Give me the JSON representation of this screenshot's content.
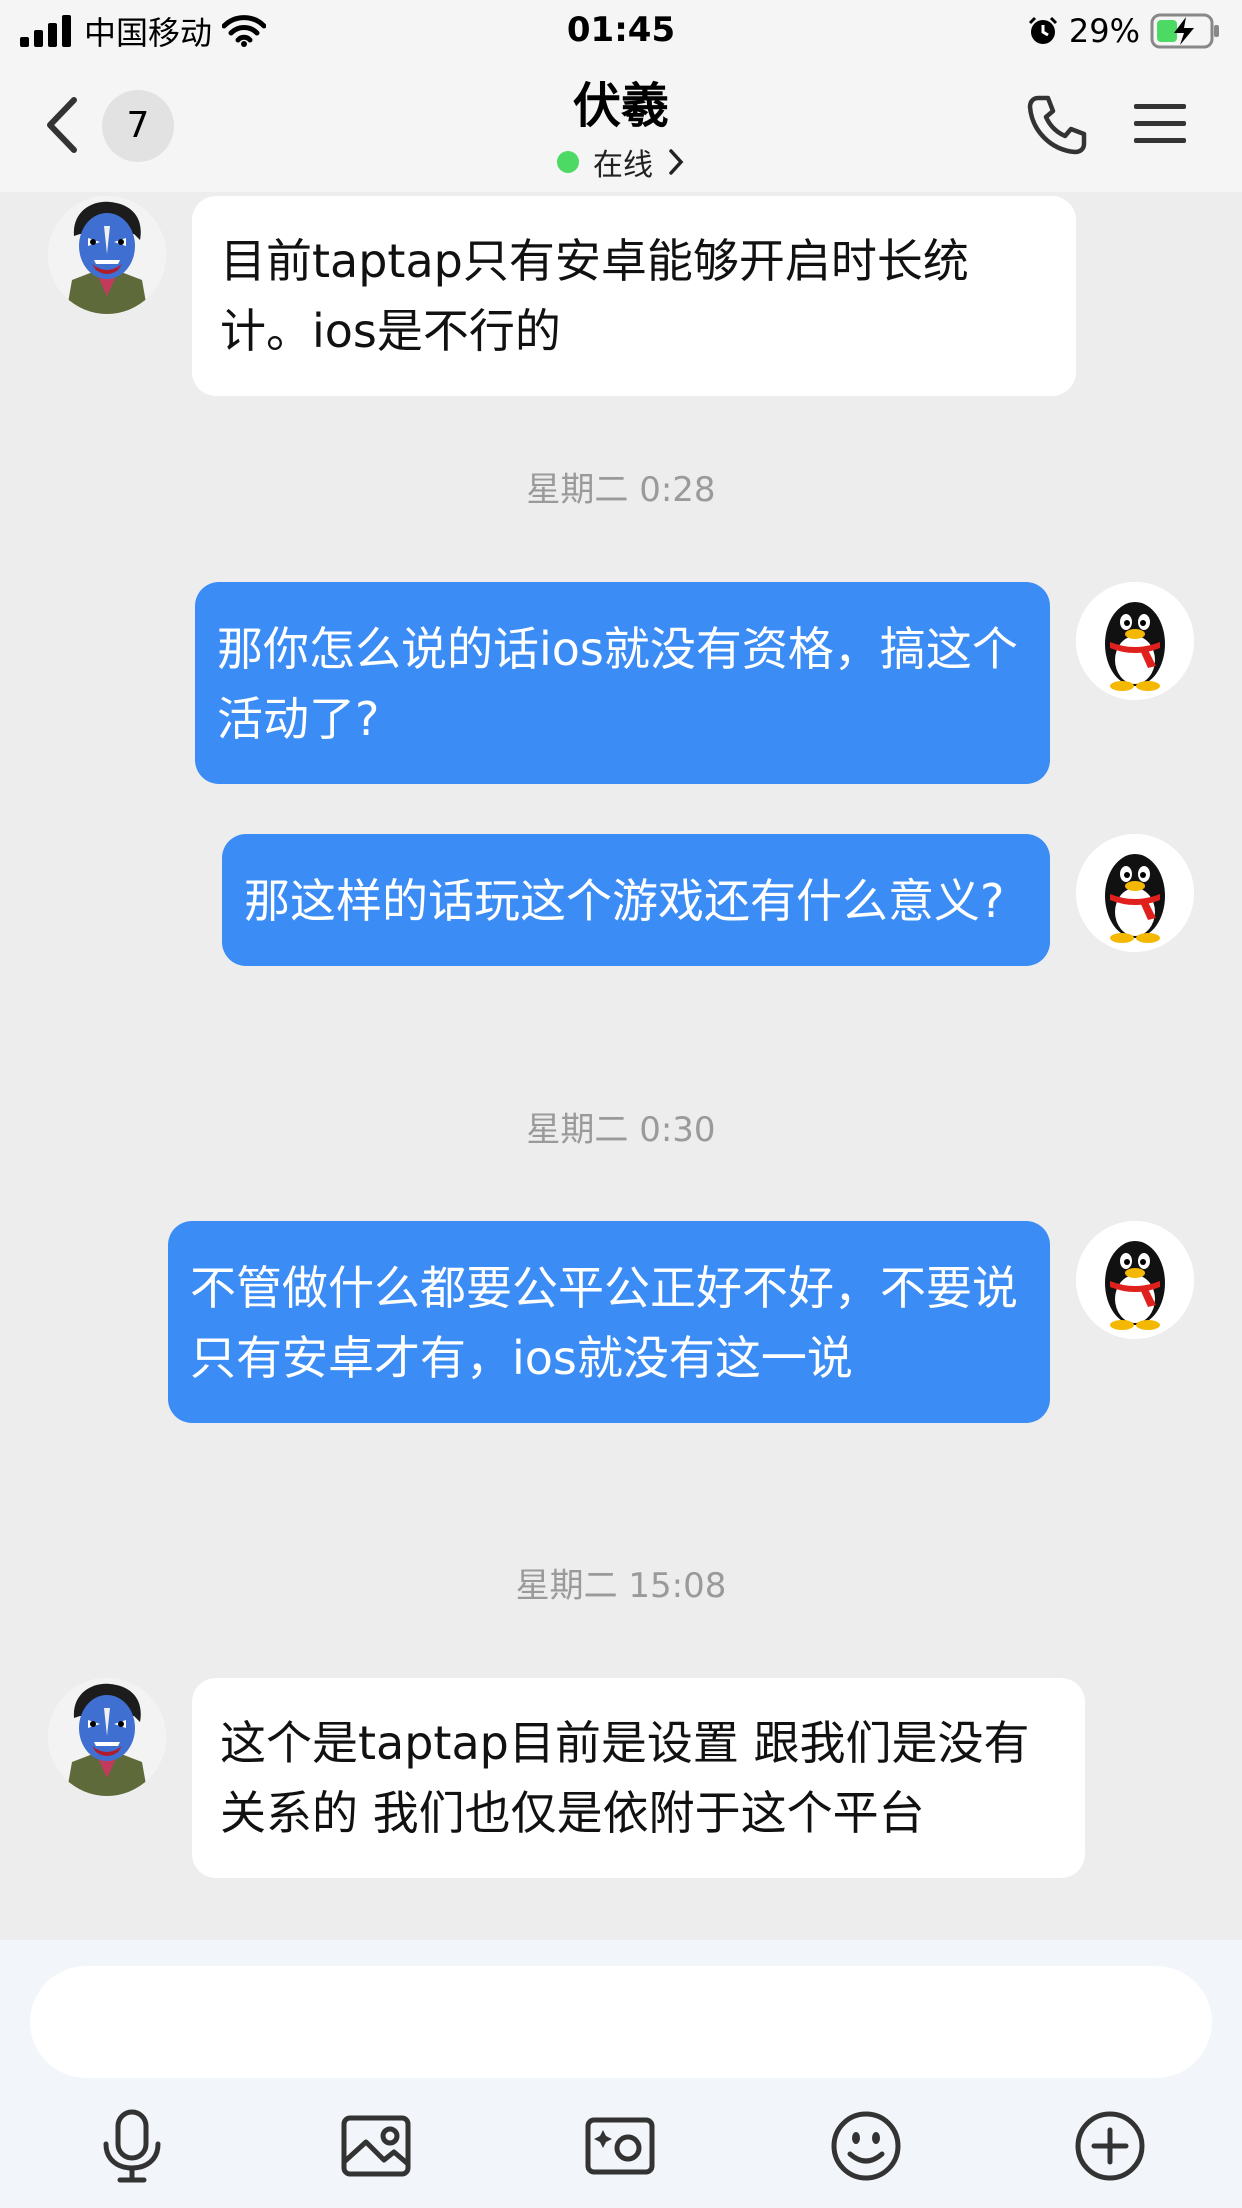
{
  "status_bar": {
    "carrier": "中国移动",
    "time": "01:45",
    "battery": "29%"
  },
  "nav": {
    "unread_count": "7",
    "contact_name": "伏羲",
    "status_text": "在线"
  },
  "messages": [
    {
      "from": "contact",
      "text": "目前taptap只有安卓能够开启时长统计。ios是不行的"
    },
    {
      "timestamp": "星期二 0:28"
    },
    {
      "from": "me",
      "text": "那你怎么说的话ios就没有资格，搞这个活动了?"
    },
    {
      "from": "me",
      "text": "那这样的话玩这个游戏还有什么意义?"
    },
    {
      "timestamp": "星期二 0:30"
    },
    {
      "from": "me",
      "text": "不管做什么都要公平公正好不好，不要说只有安卓才有，ios就没有这一说"
    },
    {
      "timestamp": "星期二 15:08"
    },
    {
      "from": "contact",
      "text": "这个是taptap目前是设置 跟我们是没有关系的 我们也仅是依附于这个平台"
    }
  ],
  "input": {
    "value": "",
    "toolbar_icons": [
      "microphone-icon",
      "image-icon",
      "camera-icon",
      "emoji-icon",
      "plus-icon"
    ]
  },
  "colors": {
    "outgoing_bubble": "#3b8cf5",
    "incoming_bubble": "#ffffff",
    "background": "#ededed",
    "online_dot": "#4cd964"
  }
}
